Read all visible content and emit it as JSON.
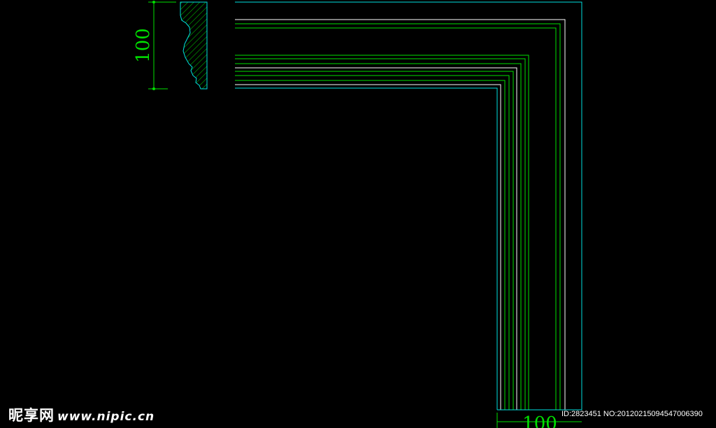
{
  "drawing": {
    "side_dimension_label": "100",
    "bottom_dimension_label": "100",
    "colors": {
      "background": "#000000",
      "outline": "#00e0e0",
      "molding_primary": "#00e000",
      "molding_secondary": "#ffffff"
    }
  },
  "watermark": {
    "site_name": "昵享网",
    "site_url": "www.nipic.cn",
    "image_info": "ID:2823451 NO:20120215094547006390"
  }
}
